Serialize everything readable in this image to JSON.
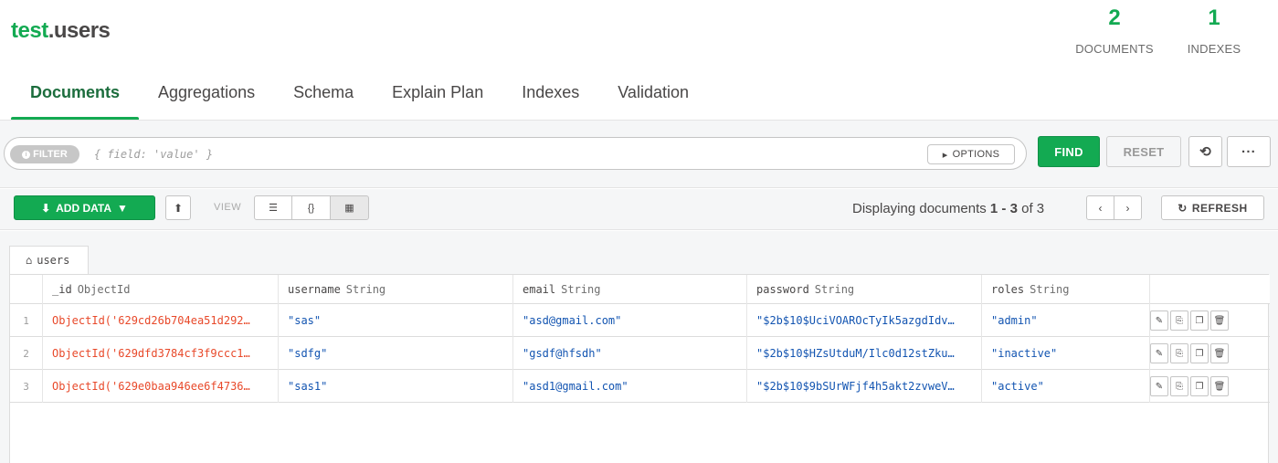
{
  "namespace": {
    "db": "test",
    "collection": ".users"
  },
  "stats": {
    "documents": {
      "count": "2",
      "label": "DOCUMENTS"
    },
    "indexes": {
      "count": "1",
      "label": "INDEXES"
    }
  },
  "tabs": [
    {
      "label": "Documents",
      "active": true
    },
    {
      "label": "Aggregations"
    },
    {
      "label": "Schema"
    },
    {
      "label": "Explain Plan"
    },
    {
      "label": "Indexes"
    },
    {
      "label": "Validation"
    }
  ],
  "query": {
    "filter_label": "FILTER",
    "filter_placeholder": "{ field: 'value' }",
    "options_label": "OPTIONS",
    "find_label": "FIND",
    "reset_label": "RESET",
    "history_icon": "history-icon",
    "more_label": "···"
  },
  "toolbar": {
    "add_data_label": "ADD DATA",
    "view_label": "VIEW",
    "views": [
      "list-view-icon",
      "json-view-icon",
      "table-view-icon"
    ],
    "pager": {
      "prefix": "Displaying documents ",
      "range": "1 - 3",
      "suffix": " of 3"
    },
    "refresh_label": "REFRESH"
  },
  "collection_tab": "users",
  "columns": [
    {
      "name": "_id",
      "type": "ObjectId"
    },
    {
      "name": "username",
      "type": "String"
    },
    {
      "name": "email",
      "type": "String"
    },
    {
      "name": "password",
      "type": "String"
    },
    {
      "name": "roles",
      "type": "String"
    }
  ],
  "rows": [
    {
      "index": "1",
      "id": "ObjectId('629cd26b704ea51d292…",
      "username": "\"sas\"",
      "email": "\"asd@gmail.com\"",
      "password": "\"$2b$10$UciVOAROcTyIk5azgdIdv…",
      "roles": "\"admin\""
    },
    {
      "index": "2",
      "id": "ObjectId('629dfd3784cf3f9ccc1…",
      "username": "\"sdfg\"",
      "email": "\"gsdf@hfsdh\"",
      "password": "\"$2b$10$HZsUtduM/Ilc0d12stZku…",
      "roles": "\"inactive\""
    },
    {
      "index": "3",
      "id": "ObjectId('629e0baa946ee6f4736…",
      "username": "\"sas1\"",
      "email": "\"asd1@gmail.com\"",
      "password": "\"$2b$10$9bSUrWFjf4h5akt2zvweV…",
      "roles": "\"active\""
    }
  ],
  "colors": {
    "accent": "#13aa52",
    "objectid": "#e8492a",
    "string": "#1254b1"
  }
}
